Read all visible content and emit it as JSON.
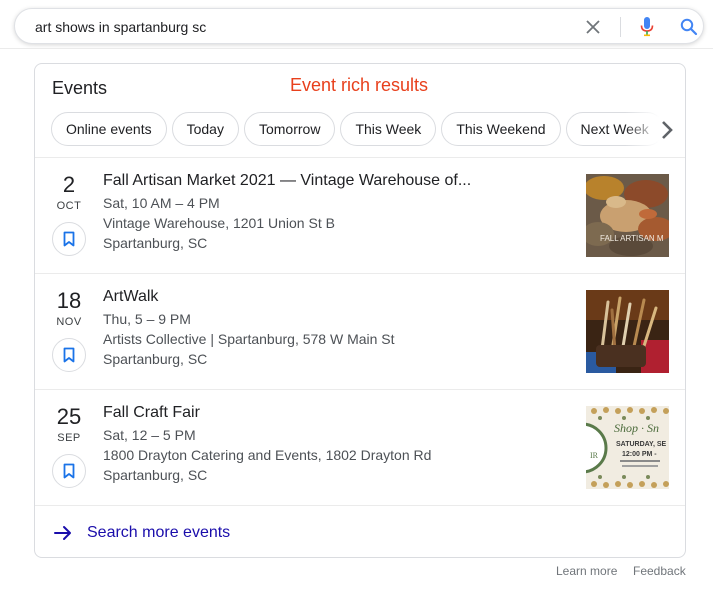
{
  "search": {
    "query": "art shows in spartanburg sc"
  },
  "events": {
    "title": "Events",
    "annotation": "Event rich results",
    "chips": [
      "Online events",
      "Today",
      "Tomorrow",
      "This Week",
      "This Weekend",
      "Next Week"
    ],
    "items": [
      {
        "day": "2",
        "month": "OCT",
        "title": "Fall Artisan Market 2021 — Vintage Warehouse of...",
        "time": "Sat, 10 AM – 4 PM",
        "venue": "Vintage Warehouse, 1201 Union St B",
        "city": "Spartanburg, SC"
      },
      {
        "day": "18",
        "month": "NOV",
        "title": "ArtWalk",
        "time": "Thu, 5 – 9 PM",
        "venue": "Artists Collective | Spartanburg, 578 W Main St",
        "city": "Spartanburg, SC"
      },
      {
        "day": "25",
        "month": "SEP",
        "title": "Fall Craft Fair",
        "time": "Sat, 12 – 5 PM",
        "venue": "1800 Drayton Catering and Events, 1802 Drayton Rd",
        "city": "Spartanburg, SC"
      }
    ],
    "thumb_texts": {
      "market": "FALL ARTISAN M",
      "fair_line1": "Shop · Sn",
      "fair_line2": "SATURDAY, SE",
      "fair_line3": "12:00 PM -",
      "fair_side": "IR"
    },
    "more_label": "Search more events"
  },
  "footer": {
    "learn_more": "Learn more",
    "feedback": "Feedback"
  },
  "colors": {
    "link": "#1a0dab",
    "annotation": "#e8401c",
    "accent_blue": "#4285f4"
  }
}
